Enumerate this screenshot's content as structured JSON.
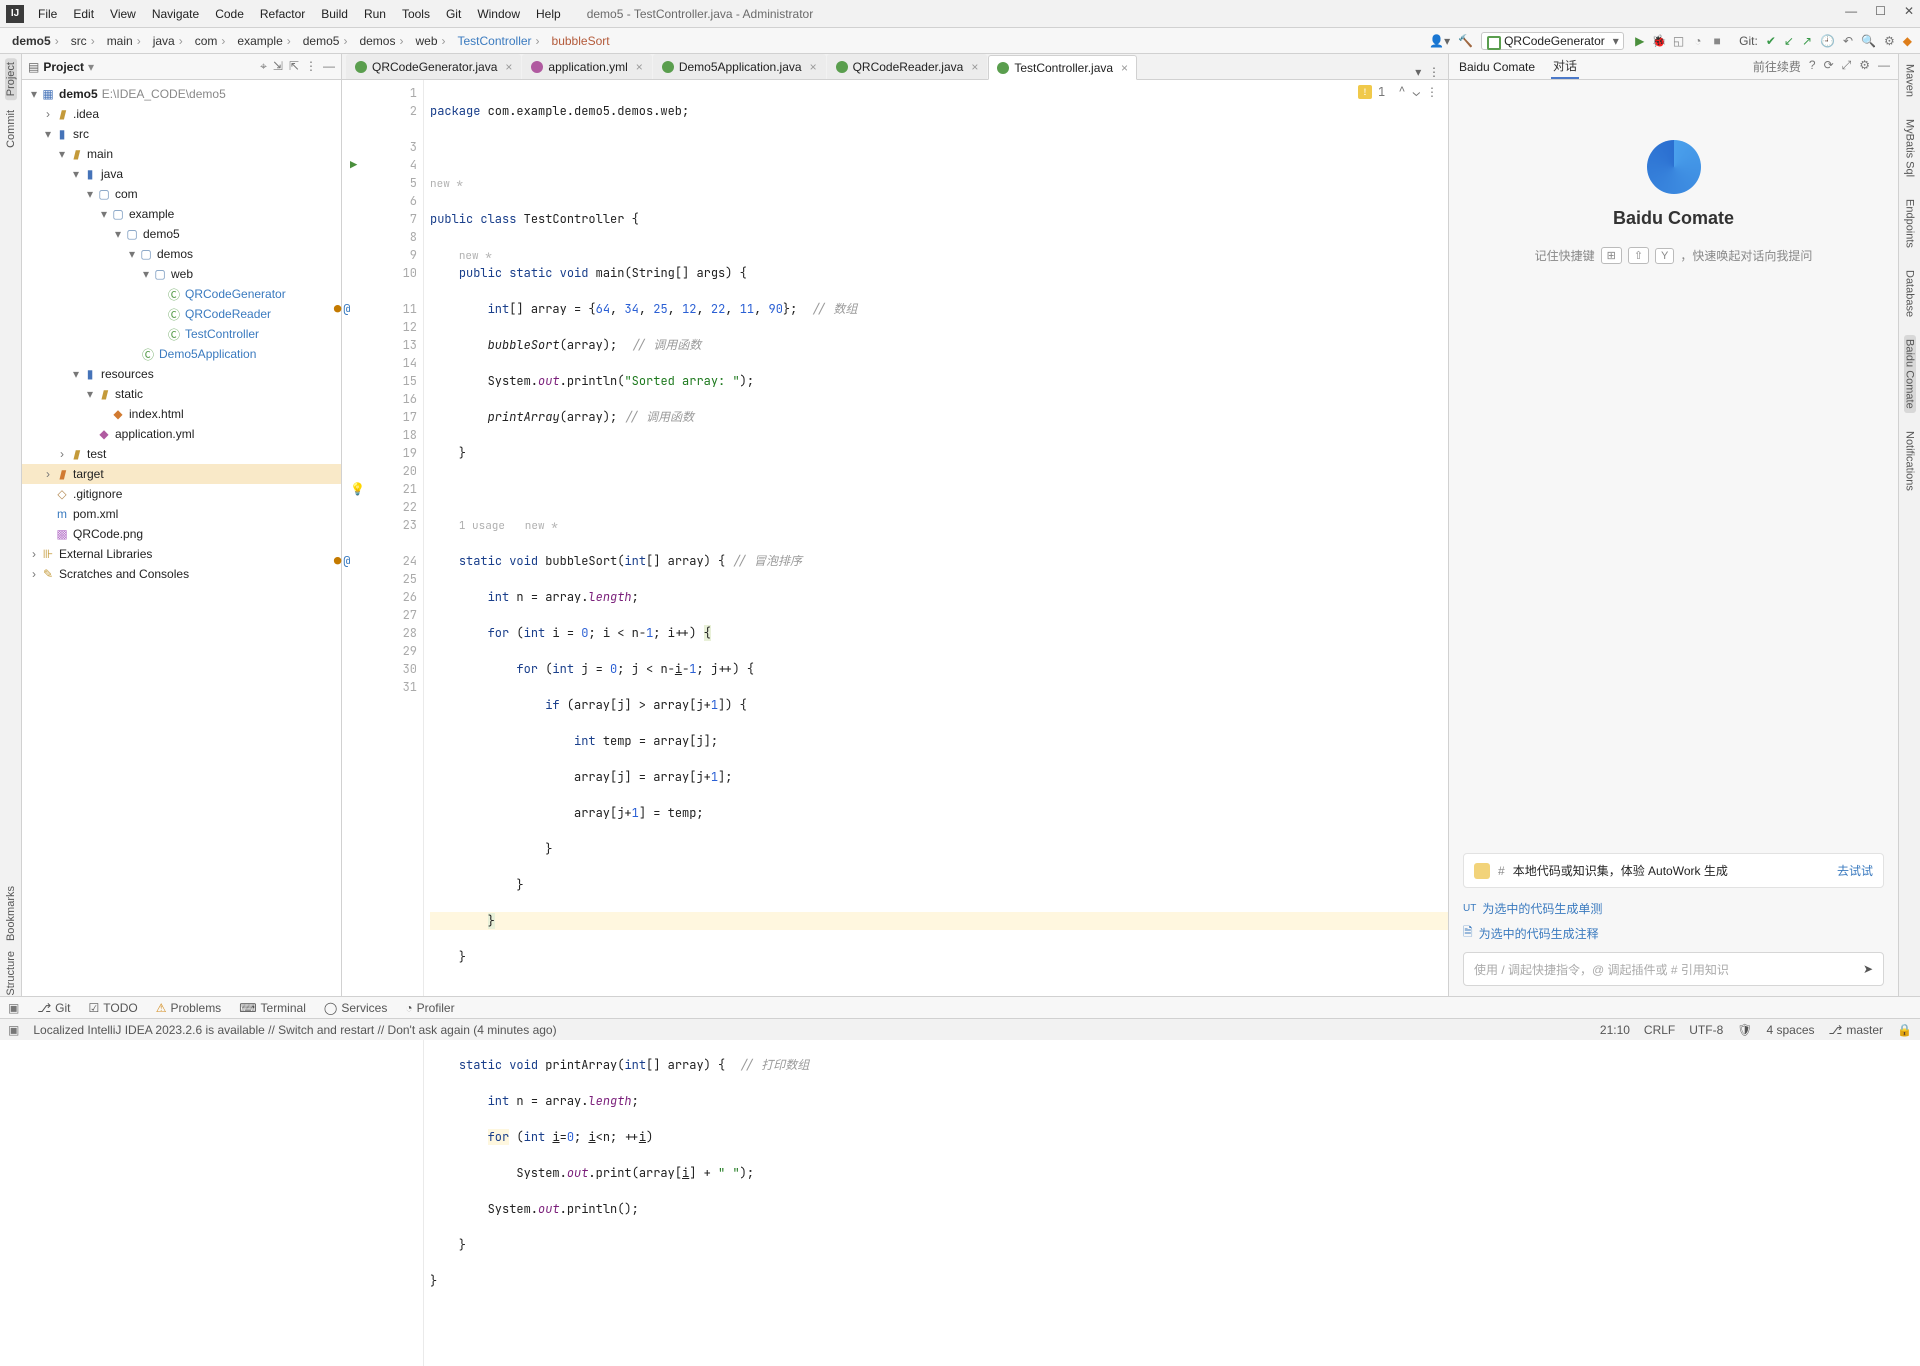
{
  "window": {
    "title": "demo5 - TestController.java - Administrator"
  },
  "menu": [
    "File",
    "Edit",
    "View",
    "Navigate",
    "Code",
    "Refactor",
    "Build",
    "Run",
    "Tools",
    "Git",
    "Window",
    "Help"
  ],
  "breadcrumbs": [
    "demo5",
    "src",
    "main",
    "java",
    "com",
    "example",
    "demo5",
    "demos",
    "web",
    "TestController",
    "bubbleSort"
  ],
  "runConfig": "QRCodeGenerator",
  "gitLabel": "Git:",
  "projectPanel": {
    "title": "Project"
  },
  "tree": {
    "root": {
      "name": "demo5",
      "path": "E:\\IDEA_CODE\\demo5"
    },
    "idea": ".idea",
    "src": "src",
    "main": "main",
    "java": "java",
    "com": "com",
    "example": "example",
    "demo5": "demo5",
    "demos": "demos",
    "web": "web",
    "QRCodeGenerator": "QRCodeGenerator",
    "QRCodeReader": "QRCodeReader",
    "TestController": "TestController",
    "Demo5Application": "Demo5Application",
    "resources": "resources",
    "static": "static",
    "indexhtml": "index.html",
    "appyml": "application.yml",
    "test": "test",
    "target": "target",
    "gitignore": ".gitignore",
    "pom": "pom.xml",
    "qrpng": "QRCode.png",
    "extlib": "External Libraries",
    "scratch": "Scratches and Consoles"
  },
  "tabs": [
    {
      "label": "QRCodeGenerator.java",
      "type": "java"
    },
    {
      "label": "application.yml",
      "type": "yml"
    },
    {
      "label": "Demo5Application.java",
      "type": "java"
    },
    {
      "label": "QRCodeReader.java",
      "type": "java"
    },
    {
      "label": "TestController.java",
      "type": "java",
      "active": true
    }
  ],
  "editor": {
    "warnCount": "1",
    "hints": {
      "new": "new *",
      "usage": "1 usage   new *"
    }
  },
  "aside": {
    "tab1": "Baidu Comate",
    "tab2": "对话",
    "goto": "前往续费",
    "brand": "Baidu Comate",
    "tipPrefix": "记住快捷键",
    "tipKey1": "⊞",
    "tipKey2": "⇧",
    "tipKey3": "Y",
    "tipSuffix": "，快速唤起对话向我提问",
    "bannerHash": "#",
    "bannerText": "本地代码或知识集，体验 AutoWork 生成",
    "bannerLink": "去试试",
    "sug1": "为选中的代码生成单测",
    "sug1pre": "UT",
    "sug2": "为选中的代码生成注释",
    "chatPlaceholder": "使用 / 调起快捷指令，@ 调起插件或 # 引用知识"
  },
  "rightGutter": [
    "Maven",
    "MyBatis Sql",
    "Endpoints",
    "Database",
    "Baidu Comate",
    "Notifications"
  ],
  "leftGutter": [
    "Project",
    "Commit",
    "Bookmarks",
    "Structure"
  ],
  "toolstrip": [
    "Git",
    "TODO",
    "Problems",
    "Terminal",
    "Services",
    "Profiler"
  ],
  "status": {
    "msg": "Localized IntelliJ IDEA 2023.2.6 is available // Switch and restart // Don't ask again (4 minutes ago)",
    "pos": "21:10",
    "sep": "CRLF",
    "enc": "UTF-8",
    "indent": "4 spaces",
    "branch": "master"
  }
}
